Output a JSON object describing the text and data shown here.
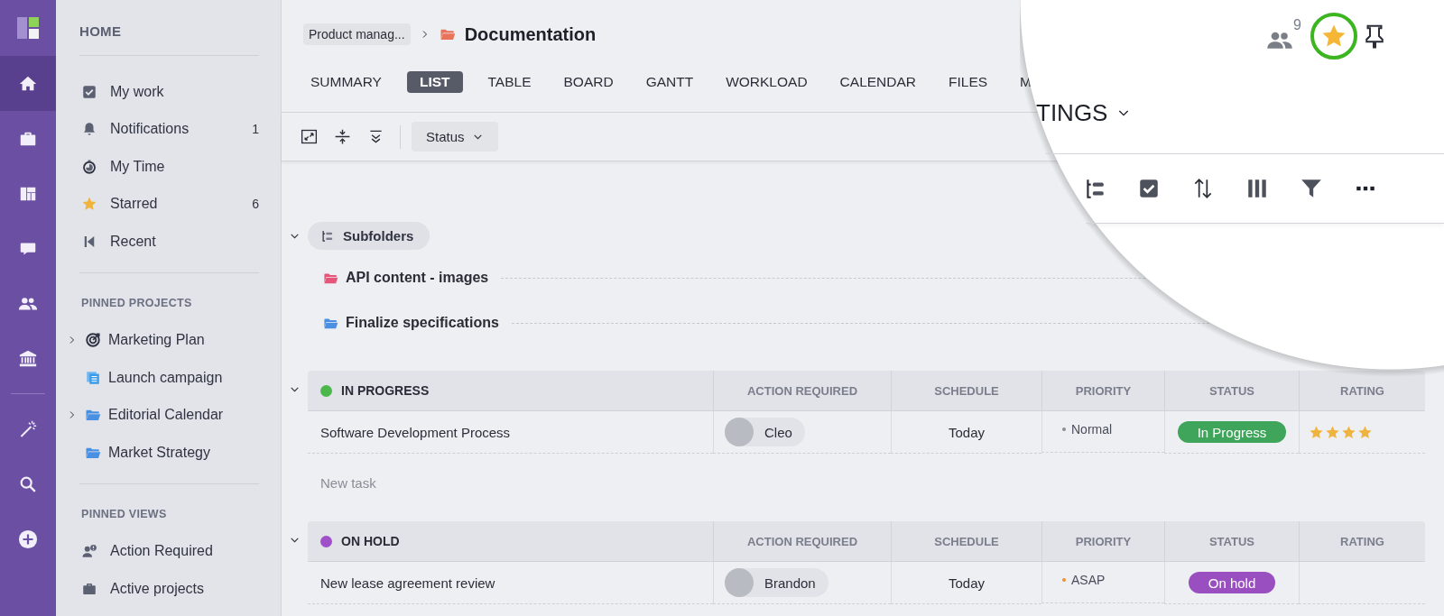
{
  "rail": {
    "items": [
      {
        "kind": "home",
        "selected": true
      },
      {
        "kind": "briefcase",
        "selected": false
      },
      {
        "kind": "dashboard",
        "selected": false
      },
      {
        "kind": "chat",
        "selected": false
      },
      {
        "kind": "people",
        "selected": false
      },
      {
        "kind": "bank",
        "selected": false
      },
      {
        "kind": "wand",
        "selected": false
      },
      {
        "kind": "search",
        "selected": false
      },
      {
        "kind": "add",
        "selected": false
      }
    ]
  },
  "sidebar": {
    "title": "HOME",
    "items": [
      {
        "kind": "check",
        "label": "My work"
      },
      {
        "kind": "bell",
        "label": "Notifications",
        "count": "1"
      },
      {
        "kind": "timer",
        "label": "My Time"
      },
      {
        "kind": "star",
        "label": "Starred",
        "count": "6"
      },
      {
        "kind": "recent",
        "label": "Recent"
      }
    ],
    "pinned_projects": {
      "title": "PINNED PROJECTS",
      "items": [
        {
          "kind": "target",
          "label": "Marketing Plan",
          "expandable": true
        },
        {
          "kind": "list",
          "label": "Launch campaign",
          "expandable": false
        },
        {
          "kind": "folder",
          "label": "Editorial Calendar",
          "expandable": true
        },
        {
          "kind": "folder",
          "label": "Market Strategy",
          "expandable": false
        }
      ]
    },
    "pinned_views": {
      "title": "PINNED VIEWS",
      "items": [
        {
          "kind": "user-alert",
          "label": "Action Required"
        },
        {
          "kind": "briefcase",
          "label": "Active projects"
        }
      ]
    }
  },
  "breadcrumb": {
    "parent": "Product manag...",
    "current": "Documentation"
  },
  "tabs": [
    {
      "label": "SUMMARY",
      "selected": false
    },
    {
      "label": "LIST",
      "selected": true
    },
    {
      "label": "TABLE",
      "selected": false
    },
    {
      "label": "BOARD",
      "selected": false
    },
    {
      "label": "GANTT",
      "selected": false
    },
    {
      "label": "WORKLOAD",
      "selected": false
    },
    {
      "label": "CALENDAR",
      "selected": false
    },
    {
      "label": "FILES",
      "selected": false
    },
    {
      "label": "M",
      "selected": false
    }
  ],
  "toolbar": {
    "status_button": "Status"
  },
  "subfolders": {
    "title": "Subfolders",
    "expanded": true,
    "items": [
      {
        "name": "API content - images",
        "color": "#e5567a"
      },
      {
        "name": "Finalize specifications",
        "color": "#4a90e2"
      }
    ]
  },
  "groups": [
    {
      "name": "IN PROGRESS",
      "color": "#4cb84c",
      "expanded": true,
      "columns": [
        "ACTION REQUIRED",
        "SCHEDULE",
        "PRIORITY",
        "STATUS",
        "RATING"
      ],
      "rows": [
        {
          "task": "Software Development Process",
          "assignee": "Cleo",
          "schedule": "Today",
          "priority": {
            "label": "Normal",
            "color": "#8a8d96"
          },
          "status": {
            "label": "In Progress",
            "color": "#3fa55a"
          },
          "stars": 4
        }
      ],
      "new_task": "New task"
    },
    {
      "name": "ON HOLD",
      "color": "#a050c8",
      "expanded": true,
      "columns": [
        "ACTION REQUIRED",
        "SCHEDULE",
        "PRIORITY",
        "STATUS",
        "RATING"
      ],
      "rows": [
        {
          "task": "New lease agreement review",
          "assignee": "Brandon",
          "schedule": "Today",
          "priority": {
            "label": "ASAP",
            "color": "#f0902a"
          },
          "status": {
            "label": "On hold",
            "color": "#9a4fc0"
          }
        }
      ]
    }
  ],
  "lens": {
    "members_count": "9",
    "starred": true,
    "settings_label": "TINGS"
  }
}
